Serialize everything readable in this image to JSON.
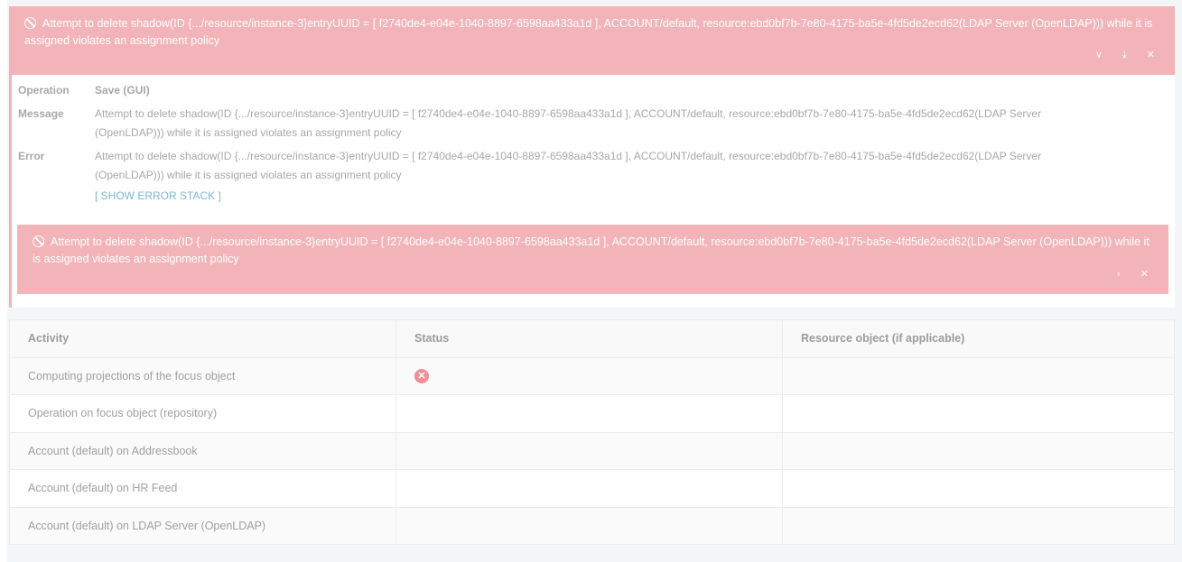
{
  "top_alert": {
    "message": "Attempt to delete shadow(ID {.../resource/instance-3}entryUUID = [ f2740de4-e04e-1040-8897-6598aa433a1d ], ACCOUNT/default, resource:ebd0bf7b-7e80-4175-ba5e-4fd5de2ecd62(LDAP Server (OpenLDAP))) while it is assigned violates an assignment policy",
    "expand_icon": "chevron-down-icon",
    "download_icon": "download-icon",
    "close_icon": "close-icon"
  },
  "details": {
    "operation_label": "Operation",
    "operation_value": "Save (GUI)",
    "message_label": "Message",
    "message_value": "Attempt to delete shadow(ID {.../resource/instance-3}entryUUID = [ f2740de4-e04e-1040-8897-6598aa433a1d ], ACCOUNT/default, resource:ebd0bf7b-7e80-4175-ba5e-4fd5de2ecd62(LDAP Server (OpenLDAP))) while it is assigned violates an assignment policy",
    "error_label": "Error",
    "error_value": "Attempt to delete shadow(ID {.../resource/instance-3}entryUUID = [ f2740de4-e04e-1040-8897-6598aa433a1d ], ACCOUNT/default, resource:ebd0bf7b-7e80-4175-ba5e-4fd5de2ecd62(LDAP Server (OpenLDAP))) while it is assigned violates an assignment policy",
    "show_stack": "[ SHOW ERROR STACK ]"
  },
  "inner_alert": {
    "message": "Attempt to delete shadow(ID {.../resource/instance-3}entryUUID = [ f2740de4-e04e-1040-8897-6598aa433a1d ], ACCOUNT/default, resource:ebd0bf7b-7e80-4175-ba5e-4fd5de2ecd62(LDAP Server (OpenLDAP))) while it is assigned violates an assignment policy"
  },
  "table": {
    "headers": [
      "Activity",
      "Status",
      "Resource object (if applicable)"
    ],
    "rows": [
      {
        "activity": "Computing projections of the focus object",
        "status": "error",
        "resource": ""
      },
      {
        "activity": "Operation on focus object (repository)",
        "status": "",
        "resource": ""
      },
      {
        "activity": "Account (default) on Addressbook",
        "status": "",
        "resource": ""
      },
      {
        "activity": "Account (default) on HR Feed",
        "status": "",
        "resource": ""
      },
      {
        "activity": "Account (default) on LDAP Server (OpenLDAP)",
        "status": "",
        "resource": ""
      }
    ]
  },
  "colors": {
    "alert_bg": "#f2b4b8",
    "error_icon": "#ee8e95",
    "link": "#7cb6d8"
  }
}
